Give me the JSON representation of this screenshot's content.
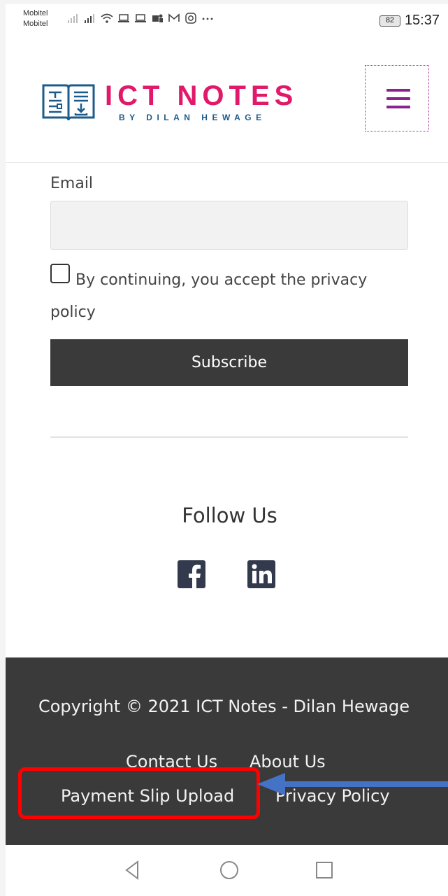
{
  "status_bar": {
    "carrier_1": "Mobitel",
    "carrier_2": "Mobitel",
    "battery": "82",
    "time": "15:37"
  },
  "header": {
    "logo_title": "ICT NOTES",
    "logo_subtitle": "BY DILAN HEWAGE"
  },
  "form": {
    "email_label": "Email",
    "email_value": "",
    "consent_text": "By continuing, you accept the privacy policy",
    "consent_checked": false,
    "subscribe_label": "Subscribe"
  },
  "follow": {
    "title": "Follow Us",
    "icons": [
      "facebook-icon",
      "linkedin-icon"
    ]
  },
  "footer": {
    "copyright": "Copyright © 2021 ICT Notes - Dilan Hewage",
    "links": {
      "contact": "Contact Us",
      "about": "About Us",
      "payment": "Payment Slip Upload",
      "privacy": "Privacy Policy"
    }
  },
  "colors": {
    "brand_pink": "#e0196b",
    "brand_blue": "#1d5b8a",
    "menu_purple": "#8b2290",
    "footer_bg": "#3a3a3a",
    "annotation_red": "#ff0000",
    "annotation_arrow": "#4472c4"
  }
}
